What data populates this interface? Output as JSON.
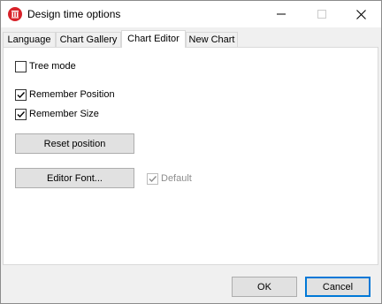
{
  "window": {
    "title": "Design time options",
    "controls": {
      "minimize_icon": "minimize-icon",
      "maximize_icon": "maximize-icon",
      "close_icon": "close-icon"
    }
  },
  "tabs": [
    {
      "label": "Language",
      "active": false
    },
    {
      "label": "Chart Gallery",
      "active": false
    },
    {
      "label": "Chart Editor",
      "active": true
    },
    {
      "label": "New Chart",
      "active": false
    }
  ],
  "options": {
    "tree_mode": {
      "label": "Tree mode",
      "checked": false
    },
    "remember_position": {
      "label": "Remember Position",
      "checked": true
    },
    "remember_size": {
      "label": "Remember Size",
      "checked": true
    },
    "default_font": {
      "label": "Default",
      "checked": true,
      "enabled": false
    }
  },
  "buttons": {
    "reset_position": "Reset position",
    "editor_font": "Editor Font...",
    "ok": "OK",
    "cancel": "Cancel"
  },
  "colors": {
    "accent": "#0078d7",
    "app_icon": "#d8232a",
    "dialog_bg": "#f0f0f0"
  }
}
